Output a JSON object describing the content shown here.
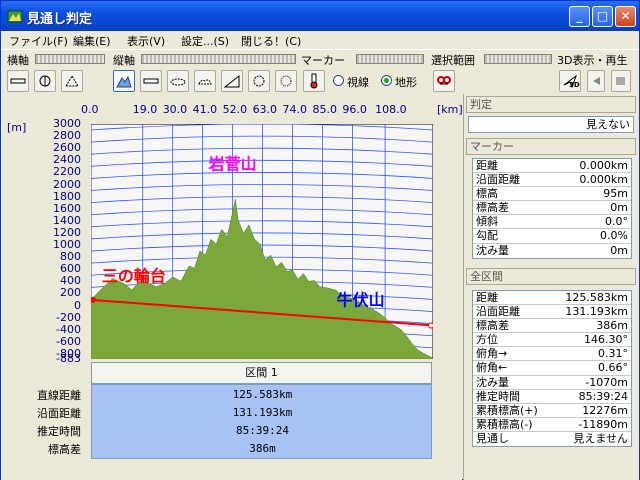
{
  "window": {
    "title": "見通し判定"
  },
  "menu": [
    {
      "label": "ファイル(F)"
    },
    {
      "label": "編集(E)"
    },
    {
      "label": "表示(V)"
    },
    {
      "label": "設定...(S)"
    },
    {
      "label": "閉じる！(C)"
    }
  ],
  "toolbar": {
    "h_axis": "横軸",
    "v_axis": "縦軸",
    "marker": "マーカー",
    "range": "選択範囲",
    "view3d": "3D表示・再生",
    "radio_visible": "視線",
    "radio_terrain": "地形",
    "btn3d": "3D"
  },
  "chart_data": {
    "type": "area",
    "x_unit": "[km]",
    "y_unit": "[m]",
    "x_ticks": [
      "0.0",
      "19.0",
      "30.0",
      "41.0",
      "52.0",
      "63.0",
      "74.0",
      "85.0",
      "96.0",
      "108.0"
    ],
    "y_ticks": [
      "3000",
      "2800",
      "2600",
      "2400",
      "2200",
      "2000",
      "1800",
      "1600",
      "1400",
      "1200",
      "1000",
      "800",
      "600",
      "400",
      "200",
      "0",
      "-200",
      "-400",
      "-600",
      "-800",
      "-883"
    ],
    "ylim": [
      -883,
      3000
    ],
    "xlim": [
      0,
      125.583
    ],
    "annotations": [
      {
        "text": "岩菅山",
        "x": 52.0,
        "y": 2250,
        "color": "#ff00ff"
      },
      {
        "text": "三の輪台",
        "x": 4.0,
        "y": 400,
        "color": "#ff0000"
      },
      {
        "text": "牛伏山",
        "x": 99.0,
        "y": 0,
        "color": "#0000ff"
      }
    ],
    "sight_line": {
      "start": [
        0,
        95
      ],
      "end": [
        125.583,
        -330
      ]
    },
    "profile_x": [
      0,
      4,
      8,
      12,
      15,
      18,
      21,
      24,
      27,
      30,
      33,
      36,
      38,
      40,
      42,
      44,
      46,
      48,
      50,
      52,
      53,
      54,
      56,
      58,
      60,
      62,
      64,
      66,
      68,
      70,
      72,
      74,
      76,
      78,
      80,
      82,
      84,
      86,
      88,
      90,
      92,
      94,
      96,
      98,
      100,
      102,
      104,
      106,
      108,
      110,
      112,
      114,
      116,
      118,
      120,
      122,
      125.583
    ],
    "profile_y": [
      95,
      300,
      450,
      350,
      250,
      420,
      380,
      300,
      350,
      480,
      420,
      650,
      600,
      900,
      850,
      1100,
      1000,
      1250,
      1150,
      1550,
      1750,
      1400,
      1200,
      1350,
      1100,
      1000,
      750,
      850,
      650,
      700,
      550,
      600,
      450,
      520,
      380,
      420,
      330,
      300,
      260,
      250,
      180,
      150,
      100,
      60,
      20,
      -20,
      -80,
      -150,
      -200,
      -280,
      -340,
      -420,
      -520,
      -620,
      -720,
      -800,
      -883
    ]
  },
  "segment": {
    "header": "区間 1",
    "labels": [
      "直線距離",
      "沿面距離",
      "推定時間",
      "標高差"
    ],
    "values": [
      "125.583km",
      "131.193km",
      "85:39:24",
      "386m"
    ]
  },
  "side": {
    "judge_head": "判定",
    "judge_value": "見えない",
    "marker_head": "マーカー",
    "marker_rows": [
      {
        "k": "距離",
        "v": "0.000km"
      },
      {
        "k": "沿面距離",
        "v": "0.000km"
      },
      {
        "k": "標高",
        "v": "95m"
      },
      {
        "k": "標高差",
        "v": "0m"
      },
      {
        "k": "傾斜",
        "v": "0.0°"
      },
      {
        "k": "勾配",
        "v": "0.0%"
      },
      {
        "k": "沈み量",
        "v": "0m"
      }
    ],
    "all_head": "全区間",
    "all_rows": [
      {
        "k": "距離",
        "v": "125.583km"
      },
      {
        "k": "沿面距離",
        "v": "131.193km"
      },
      {
        "k": "標高差",
        "v": "386m"
      },
      {
        "k": "方位",
        "v": "146.30°"
      },
      {
        "k": "俯角→",
        "v": "0.31°"
      },
      {
        "k": "俯角←",
        "v": "0.66°"
      },
      {
        "k": "沈み量",
        "v": "-1070m"
      },
      {
        "k": "推定時間",
        "v": "85:39:24"
      },
      {
        "k": "累積標高(+)",
        "v": "12276m"
      },
      {
        "k": "累積標高(-)",
        "v": "-11890m"
      },
      {
        "k": "見通し",
        "v": "見えません"
      }
    ]
  }
}
